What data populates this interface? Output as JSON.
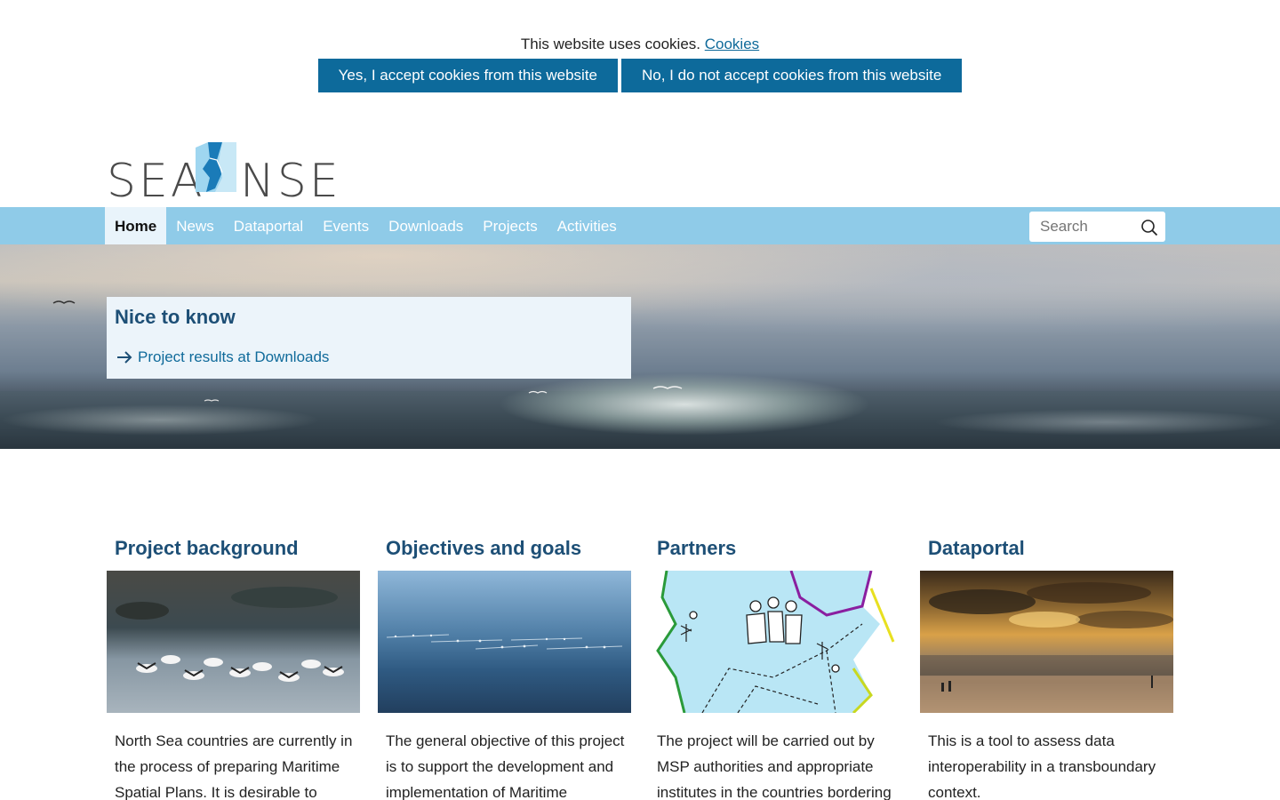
{
  "cookie": {
    "message": "This website uses cookies.",
    "link": "Cookies",
    "accept": "Yes, I accept cookies from this website",
    "decline": "No, I do not accept cookies from this website"
  },
  "logo": {
    "left": "SEA",
    "right": "NSE"
  },
  "nav": {
    "items": [
      "Home",
      "News",
      "Dataportal",
      "Events",
      "Downloads",
      "Projects",
      "Activities"
    ],
    "active": "Home"
  },
  "search": {
    "placeholder": "Search"
  },
  "nice_to_know": {
    "title": "Nice to know",
    "link": "Project results at Downloads"
  },
  "cards": [
    {
      "title": "Project background",
      "text": "North Sea countries are currently in the process of preparing Maritime Spatial Plans. It is desirable to"
    },
    {
      "title": "Objectives and goals",
      "text": "The general objective of this project is to support the development and implementation of Maritime"
    },
    {
      "title": "Partners",
      "text": "The project will be carried out by MSP authorities and appropriate institutes in the countries bordering"
    },
    {
      "title": "Dataportal",
      "text": "This is a tool to assess data interoperability in a transboundary context."
    }
  ],
  "colors": {
    "accent": "#0d6a9b",
    "nav_bg": "#8fcbe8",
    "heading": "#1d4f76"
  }
}
